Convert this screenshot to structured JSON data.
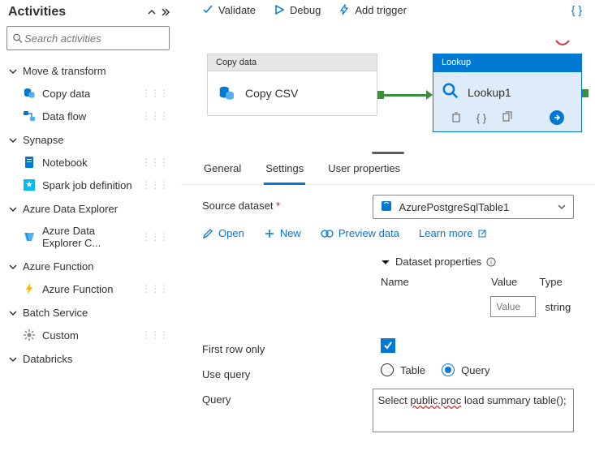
{
  "sidebar": {
    "title": "Activities",
    "search_placeholder": "Search activities",
    "categories": [
      {
        "label": "Move & transform",
        "items": [
          {
            "label": "Copy data",
            "icon": "copy-data-icon"
          },
          {
            "label": "Data flow",
            "icon": "data-flow-icon"
          }
        ]
      },
      {
        "label": "Synapse",
        "items": [
          {
            "label": "Notebook",
            "icon": "notebook-icon"
          },
          {
            "label": "Spark job definition",
            "icon": "spark-icon"
          }
        ]
      },
      {
        "label": "Azure Data Explorer",
        "items": [
          {
            "label": "Azure Data Explorer C...",
            "icon": "adx-icon"
          }
        ]
      },
      {
        "label": "Azure Function",
        "items": [
          {
            "label": "Azure Function",
            "icon": "function-icon"
          }
        ]
      },
      {
        "label": "Batch Service",
        "items": [
          {
            "label": "Custom",
            "icon": "custom-icon"
          }
        ]
      },
      {
        "label": "Databricks",
        "items": []
      }
    ]
  },
  "toolbar": {
    "validate": "Validate",
    "debug": "Debug",
    "add_trigger": "Add trigger"
  },
  "canvas": {
    "copy": {
      "header": "Copy data",
      "label": "Copy CSV"
    },
    "lookup": {
      "header": "Lookup",
      "label": "Lookup1"
    }
  },
  "tabs": {
    "general": "General",
    "settings": "Settings",
    "user_props": "User properties"
  },
  "form": {
    "source_dataset_label": "Source dataset",
    "source_dataset_value": "AzurePostgreSqlTable1",
    "links": {
      "open": "Open",
      "new": "New",
      "preview": "Preview data",
      "learn": "Learn more"
    },
    "dataset_props_header": "Dataset properties",
    "cols": {
      "name": "Name",
      "value": "Value",
      "type": "Type"
    },
    "value_placeholder": "Value",
    "row_type": "string",
    "first_row_label": "First row only",
    "first_row_checked": true,
    "use_query_label": "Use query",
    "radios": {
      "table": "Table",
      "query": "Query"
    },
    "radio_selected": "query",
    "query_label": "Query",
    "query_value_pre": "Select ",
    "query_value_underlined": "public.proc",
    "query_value_post": " load summary table();"
  }
}
